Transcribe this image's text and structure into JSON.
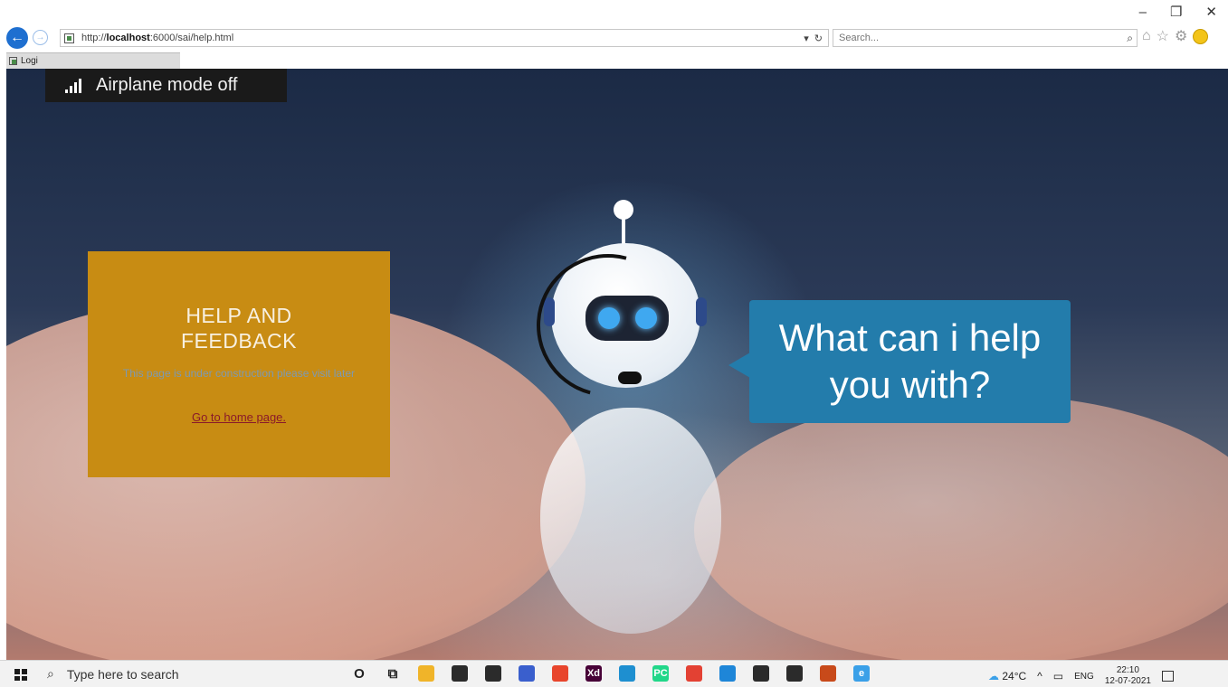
{
  "window": {
    "minimize": "–",
    "restore": "❐",
    "close": "✕"
  },
  "browser": {
    "url_prefix": "http://",
    "url_host": "localhost",
    "url_rest": ":6000/sai/help.html",
    "url_dropdown": "▾",
    "refresh": "↻",
    "search_placeholder": "Search...",
    "tab_title": "Logi"
  },
  "notification": {
    "text": "Airplane mode off"
  },
  "help_card": {
    "title_line1": "HELP AND",
    "title_line2": "FEEDBACK",
    "message": "This page is under construction please visit later",
    "link": "Go to home page."
  },
  "bubble": {
    "line1": "What can i help",
    "line2": "you with?"
  },
  "taskbar": {
    "search_placeholder": "Type here to search",
    "pinned": [
      {
        "name": "cortana-icon",
        "glyph": "O",
        "color": "#222222"
      },
      {
        "name": "task-view-icon",
        "glyph": "⧉",
        "color": "#222222"
      },
      {
        "name": "file-explorer-icon",
        "glyph": "",
        "color": "#f0b429"
      },
      {
        "name": "store-icon",
        "glyph": "",
        "color": "#2b2b2b"
      },
      {
        "name": "mail-icon",
        "glyph": "",
        "color": "#2b2b2b"
      },
      {
        "name": "app-blue-icon",
        "glyph": "",
        "color": "#3a5fcd"
      },
      {
        "name": "app-photos-icon",
        "glyph": "",
        "color": "#e8452c"
      },
      {
        "name": "adobe-xd-icon",
        "glyph": "Xd",
        "color": "#470137"
      },
      {
        "name": "edge-icon",
        "glyph": "",
        "color": "#1e8fd0"
      },
      {
        "name": "pycharm-icon",
        "glyph": "PC",
        "color": "#21d789"
      },
      {
        "name": "chrome-icon",
        "glyph": "",
        "color": "#e34133"
      },
      {
        "name": "vscode-icon",
        "glyph": "",
        "color": "#1e86d8"
      },
      {
        "name": "terminal-icon",
        "glyph": "",
        "color": "#2b2b2b"
      },
      {
        "name": "photos-icon",
        "glyph": "",
        "color": "#2b2b2b"
      },
      {
        "name": "paint-icon",
        "glyph": "",
        "color": "#c84a1a"
      },
      {
        "name": "internet-explorer-icon",
        "glyph": "e",
        "color": "#3aa0e8"
      }
    ],
    "weather": "24°C",
    "chevron": "^",
    "language": "ENG",
    "time": "22:10",
    "date": "12-07-2021"
  }
}
